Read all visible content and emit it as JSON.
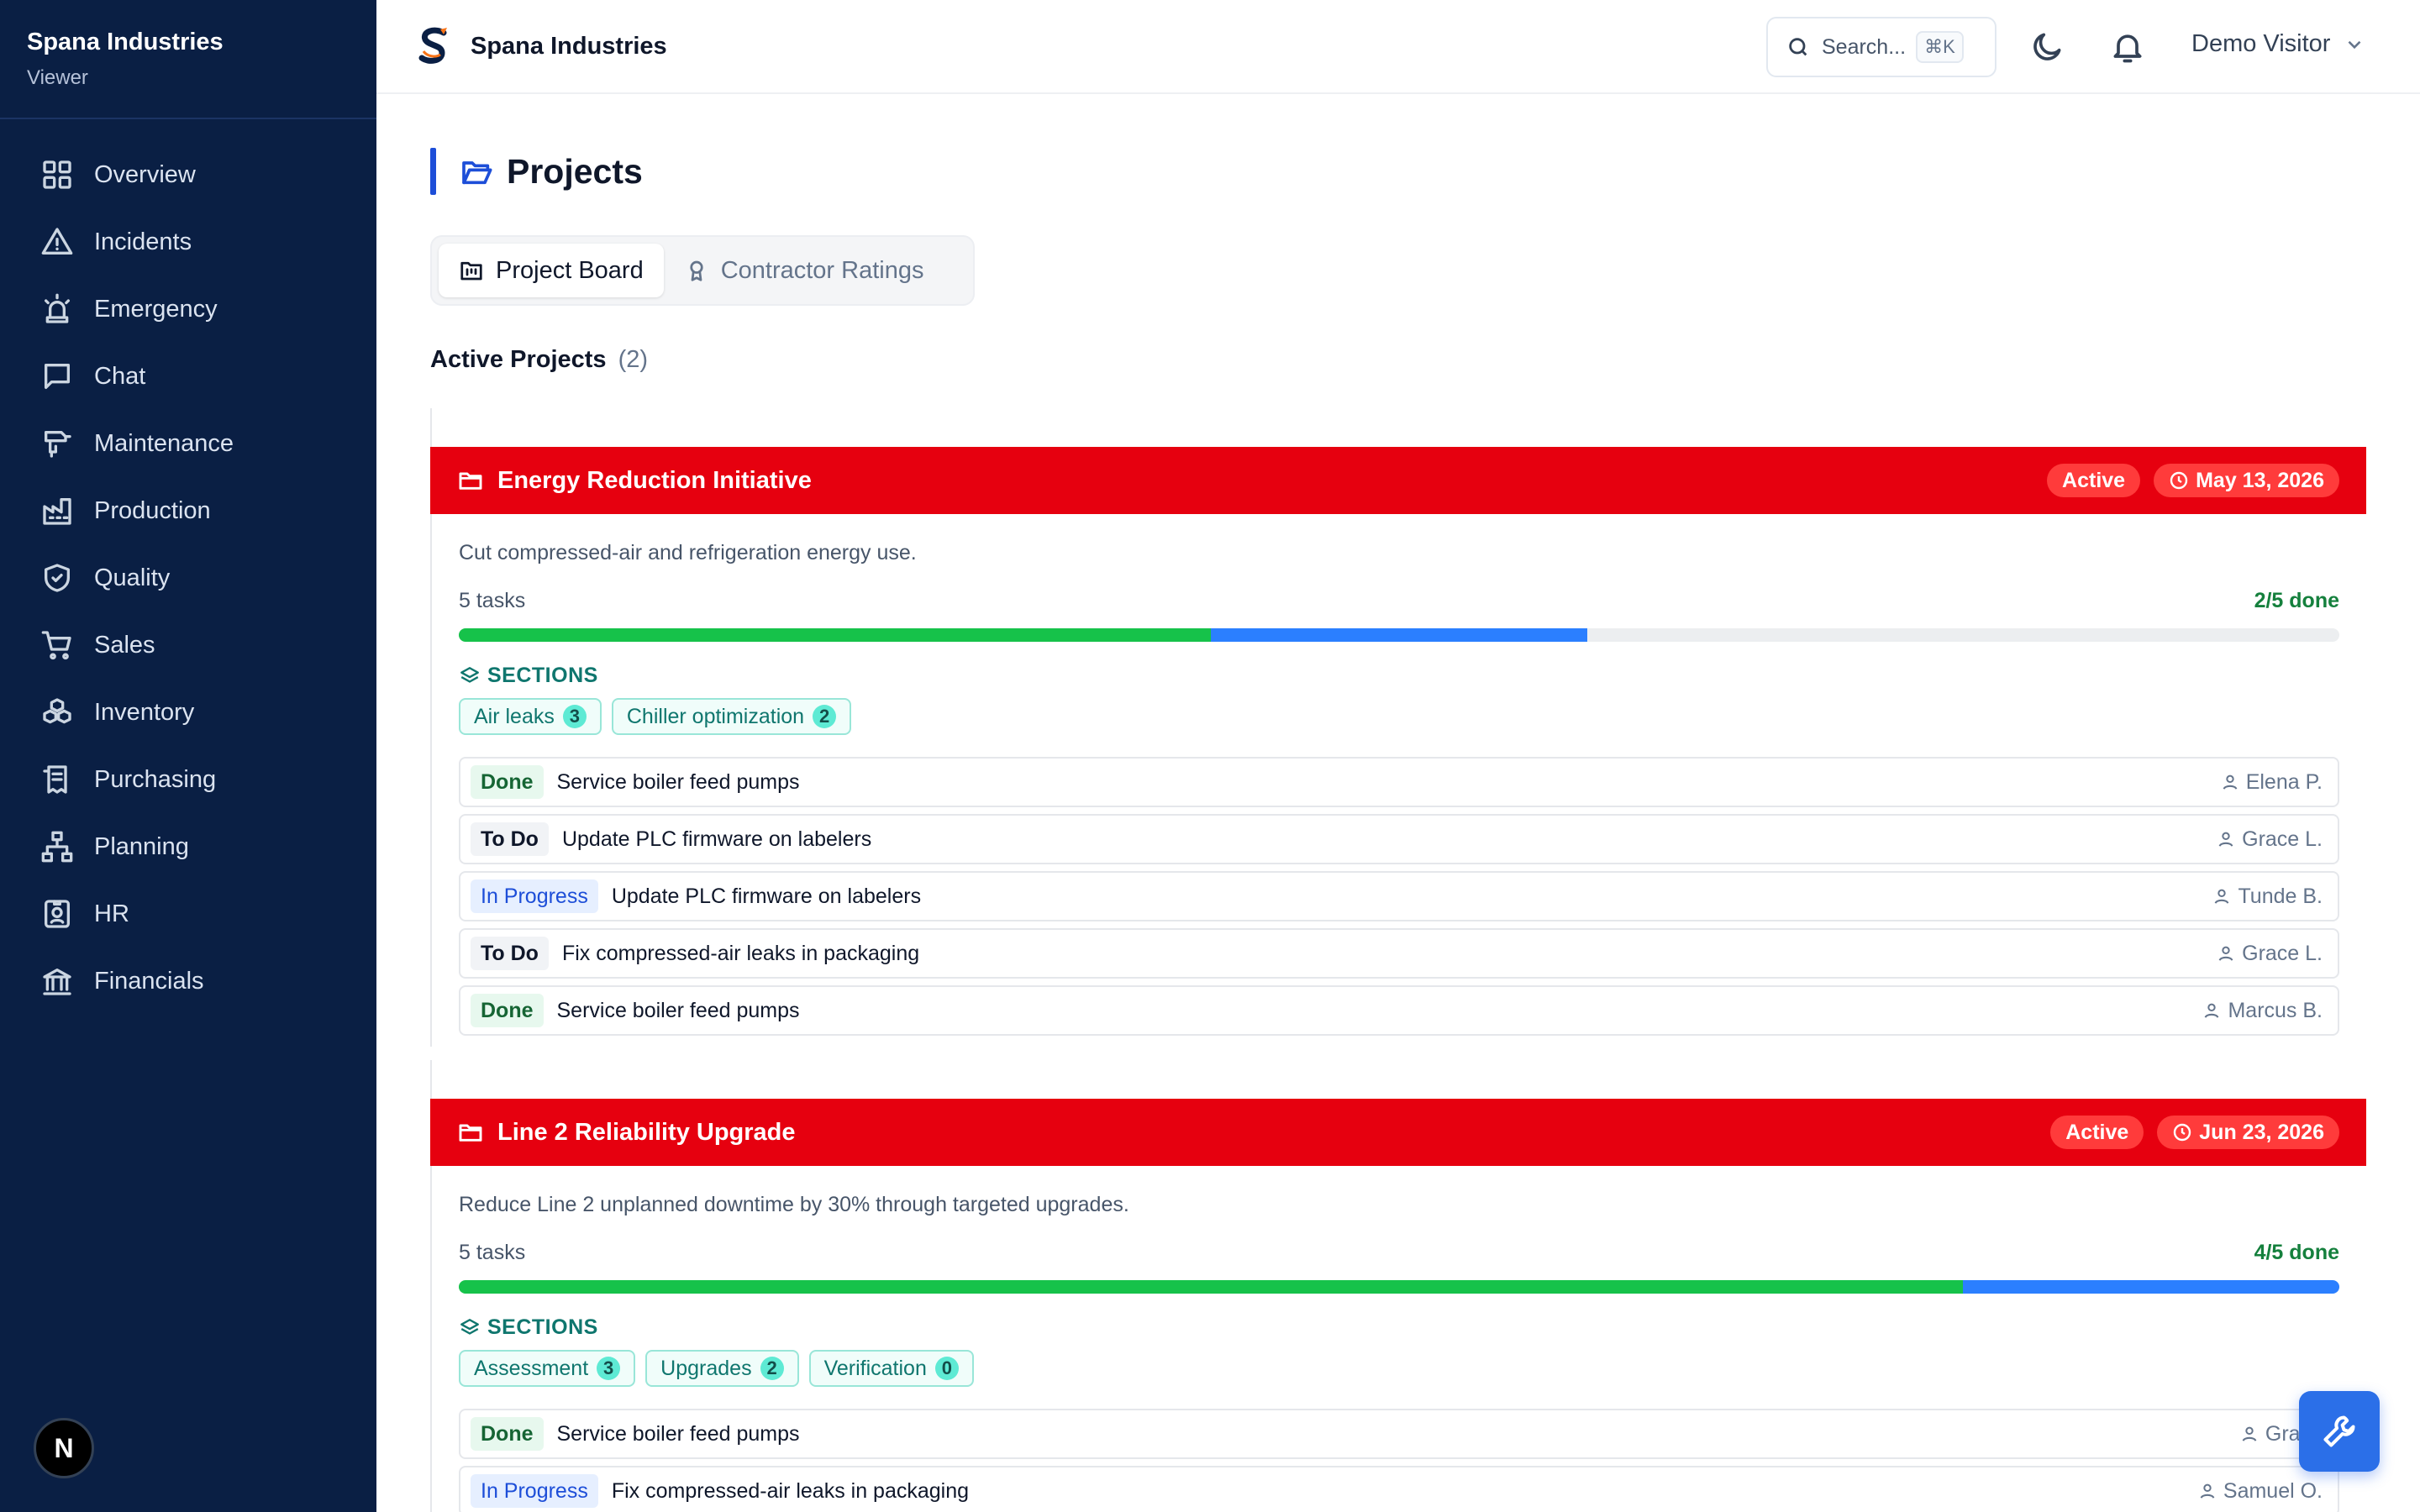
{
  "sidebar": {
    "brand": "Spana Industries",
    "role": "Viewer",
    "items": [
      {
        "label": "Overview",
        "icon": "grid-icon"
      },
      {
        "label": "Incidents",
        "icon": "alert-triangle-icon"
      },
      {
        "label": "Emergency",
        "icon": "siren-icon"
      },
      {
        "label": "Chat",
        "icon": "message-square-icon"
      },
      {
        "label": "Maintenance",
        "icon": "drill-icon"
      },
      {
        "label": "Production",
        "icon": "factory-icon"
      },
      {
        "label": "Quality",
        "icon": "shield-check-icon"
      },
      {
        "label": "Sales",
        "icon": "cart-icon"
      },
      {
        "label": "Inventory",
        "icon": "boxes-icon"
      },
      {
        "label": "Purchasing",
        "icon": "receipt-icon"
      },
      {
        "label": "Planning",
        "icon": "network-icon"
      },
      {
        "label": "HR",
        "icon": "id-badge-icon"
      },
      {
        "label": "Financials",
        "icon": "bank-icon"
      }
    ],
    "avatar_letter": "N"
  },
  "header": {
    "title": "Spana Industries",
    "search_placeholder": "Search...",
    "search_shortcut": "⌘K",
    "user": "Demo Visitor"
  },
  "page": {
    "title": "Projects",
    "tabs": [
      {
        "label": "Project Board",
        "active": true
      },
      {
        "label": "Contractor Ratings",
        "active": false
      }
    ],
    "section_title": "Active Projects",
    "section_count": "(2)"
  },
  "projects": [
    {
      "name": "Energy Reduction Initiative",
      "status": "Active",
      "date": "May 13, 2026",
      "description": "Cut compressed-air and refrigeration energy use.",
      "tasks_label": "5 tasks",
      "done_label": "2/5 done",
      "progress": {
        "done": 0.4,
        "in_progress": 0.2
      },
      "sections_label": "SECTIONS",
      "sections": [
        {
          "name": "Air leaks",
          "count": "3"
        },
        {
          "name": "Chiller optimization",
          "count": "2"
        }
      ],
      "tasks": [
        {
          "status": "Done",
          "title": "Service boiler feed pumps",
          "assignee": "Elena P."
        },
        {
          "status": "To Do",
          "title": "Update PLC firmware on labelers",
          "assignee": "Grace L."
        },
        {
          "status": "In Progress",
          "title": "Update PLC firmware on labelers",
          "assignee": "Tunde B."
        },
        {
          "status": "To Do",
          "title": "Fix compressed-air leaks in packaging",
          "assignee": "Grace L."
        },
        {
          "status": "Done",
          "title": "Service boiler feed pumps",
          "assignee": "Marcus B."
        }
      ]
    },
    {
      "name": "Line 2 Reliability Upgrade",
      "status": "Active",
      "date": "Jun 23, 2026",
      "description": "Reduce Line 2 unplanned downtime by 30% through targeted upgrades.",
      "tasks_label": "5 tasks",
      "done_label": "4/5 done",
      "progress": {
        "done": 0.8,
        "in_progress": 0.2
      },
      "sections_label": "SECTIONS",
      "sections": [
        {
          "name": "Assessment",
          "count": "3"
        },
        {
          "name": "Upgrades",
          "count": "2"
        },
        {
          "name": "Verification",
          "count": "0"
        }
      ],
      "tasks": [
        {
          "status": "Done",
          "title": "Service boiler feed pumps",
          "assignee": "Grace"
        },
        {
          "status": "In Progress",
          "title": "Fix compressed-air leaks in packaging",
          "assignee": "Samuel O."
        }
      ]
    }
  ],
  "colors": {
    "sidebar_bg": "#0a1f44",
    "project_header": "#e6000f",
    "progress_done": "#16c24a",
    "progress_in_progress": "#2b7fff",
    "accent": "#1d4ed8"
  },
  "fab_icon": "wrench-icon"
}
